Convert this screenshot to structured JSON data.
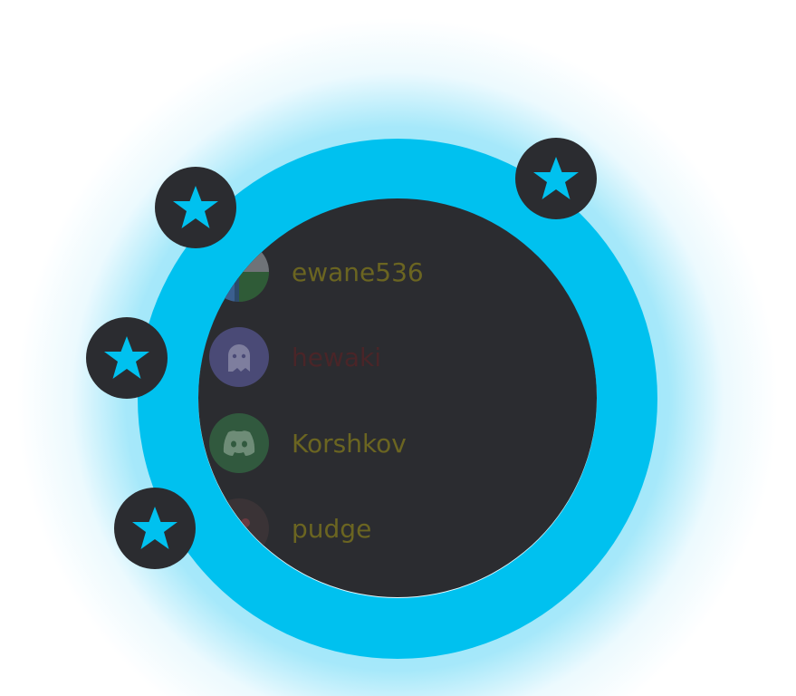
{
  "users": [
    {
      "name": "ewane536",
      "color": "#6b6521",
      "avatar_icon": "multicolor-avatar-icon"
    },
    {
      "name": "hewaki",
      "color": "#4a2528",
      "avatar_icon": "ghost-icon",
      "avatar_bg": "#4a4a76"
    },
    {
      "name": "Korshkov",
      "color": "#6b6521",
      "avatar_icon": "discord-logo-icon",
      "avatar_bg": "#31593e"
    },
    {
      "name": "pudge",
      "color": "#6b6521",
      "avatar_icon": "dark-avatar-icon",
      "avatar_bg": "#3a3336"
    }
  ],
  "theme": {
    "accent": "#00c1ef",
    "panel": "#2b2c30",
    "star_color": "#00c1ef"
  },
  "badges": [
    "star-icon",
    "star-icon",
    "star-icon",
    "star-icon"
  ]
}
